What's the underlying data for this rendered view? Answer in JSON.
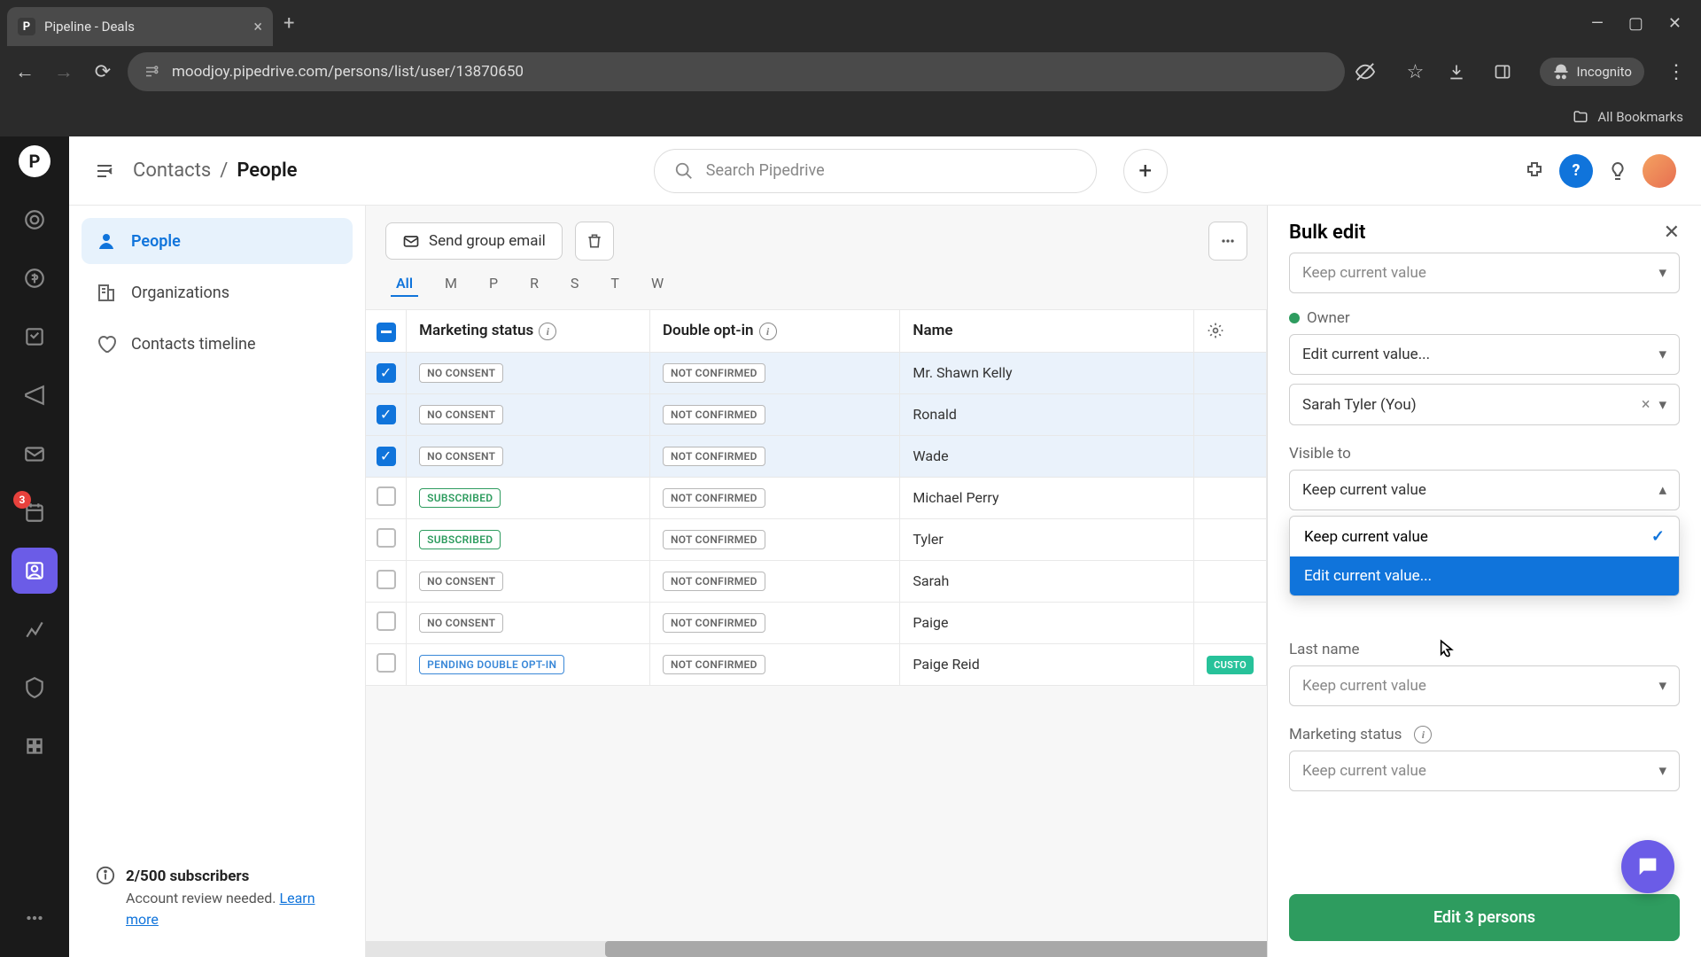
{
  "browser": {
    "tab_title": "Pipeline - Deals",
    "tab_favicon": "P",
    "url": "moodjoy.pipedrive.com/persons/list/user/13870650",
    "incognito": "Incognito",
    "all_bookmarks": "All Bookmarks"
  },
  "rail": {
    "badge_count": "3"
  },
  "breadcrumb": {
    "parent": "Contacts",
    "sep": "/",
    "current": "People"
  },
  "search_placeholder": "Search Pipedrive",
  "sidebar": {
    "items": [
      {
        "label": "People"
      },
      {
        "label": "Organizations"
      },
      {
        "label": "Contacts timeline"
      }
    ],
    "notice": {
      "title": "2/500 subscribers",
      "body": "Account review needed.",
      "link": "Learn more"
    }
  },
  "toolbar": {
    "send_group_email": "Send group email"
  },
  "alpha_filters": [
    "All",
    "M",
    "P",
    "R",
    "S",
    "T",
    "W"
  ],
  "columns": {
    "marketing_status": "Marketing status",
    "double_opt_in": "Double opt-in",
    "name": "Name"
  },
  "rows": [
    {
      "selected": true,
      "mkt": "NO CONSENT",
      "mkt_style": "gray",
      "dbl": "NOT CONFIRMED",
      "name": "Mr. Shawn Kelly"
    },
    {
      "selected": true,
      "mkt": "NO CONSENT",
      "mkt_style": "gray",
      "dbl": "NOT CONFIRMED",
      "name": "Ronald"
    },
    {
      "selected": true,
      "mkt": "NO CONSENT",
      "mkt_style": "gray",
      "dbl": "NOT CONFIRMED",
      "name": "Wade"
    },
    {
      "selected": false,
      "mkt": "SUBSCRIBED",
      "mkt_style": "green",
      "dbl": "NOT CONFIRMED",
      "name": "Michael Perry"
    },
    {
      "selected": false,
      "mkt": "SUBSCRIBED",
      "mkt_style": "green",
      "dbl": "NOT CONFIRMED",
      "name": "Tyler"
    },
    {
      "selected": false,
      "mkt": "NO CONSENT",
      "mkt_style": "gray",
      "dbl": "NOT CONFIRMED",
      "name": "Sarah"
    },
    {
      "selected": false,
      "mkt": "NO CONSENT",
      "mkt_style": "gray",
      "dbl": "NOT CONFIRMED",
      "name": "Paige"
    },
    {
      "selected": false,
      "mkt": "PENDING DOUBLE OPT-IN",
      "mkt_style": "blue",
      "dbl": "NOT CONFIRMED",
      "name": "Paige Reid",
      "badge": "CUSTO"
    }
  ],
  "panel": {
    "title": "Bulk edit",
    "fields": {
      "top_select": "Keep current value",
      "owner_label": "Owner",
      "owner_select": "Edit current value...",
      "owner_value": "Sarah Tyler (You)",
      "visible_label": "Visible to",
      "visible_select": "Keep current value",
      "dropdown_opt1": "Keep current value",
      "dropdown_opt2": "Edit current value...",
      "lastname_label": "Last name",
      "lastname_select": "Keep current value",
      "mkt_label": "Marketing status",
      "mkt_select": "Keep current value"
    },
    "submit": "Edit 3 persons"
  }
}
